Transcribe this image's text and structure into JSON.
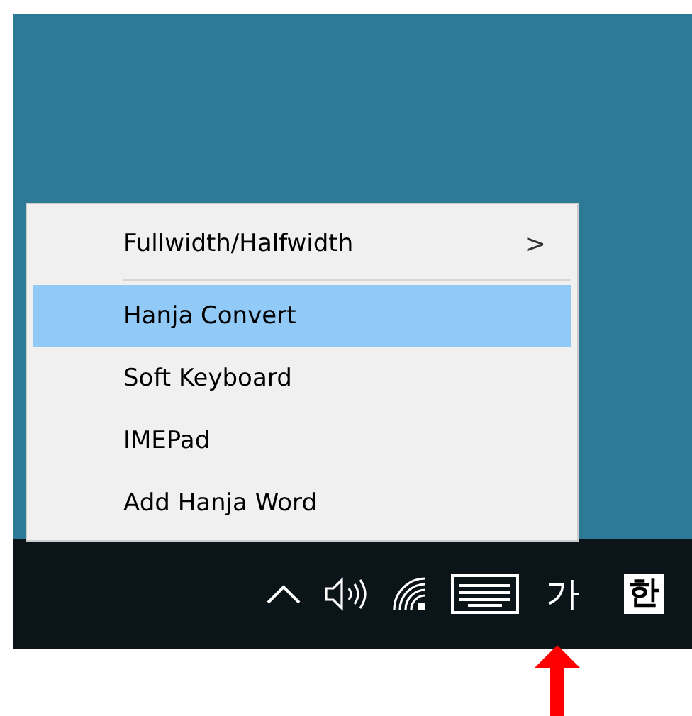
{
  "menu": {
    "items": [
      {
        "label": "Fullwidth/Halfwidth",
        "kind": "submenu",
        "submenu_glyph": ">",
        "selected": false
      },
      {
        "kind": "separator"
      },
      {
        "label": "Hanja Convert",
        "kind": "item",
        "selected": true
      },
      {
        "label": "Soft Keyboard",
        "kind": "item",
        "selected": false
      },
      {
        "label": "IMEPad",
        "kind": "item",
        "selected": false
      },
      {
        "label": "Add Hanja Word",
        "kind": "item",
        "selected": false
      }
    ]
  },
  "tray": {
    "ime_mode": "가",
    "language": "한"
  }
}
